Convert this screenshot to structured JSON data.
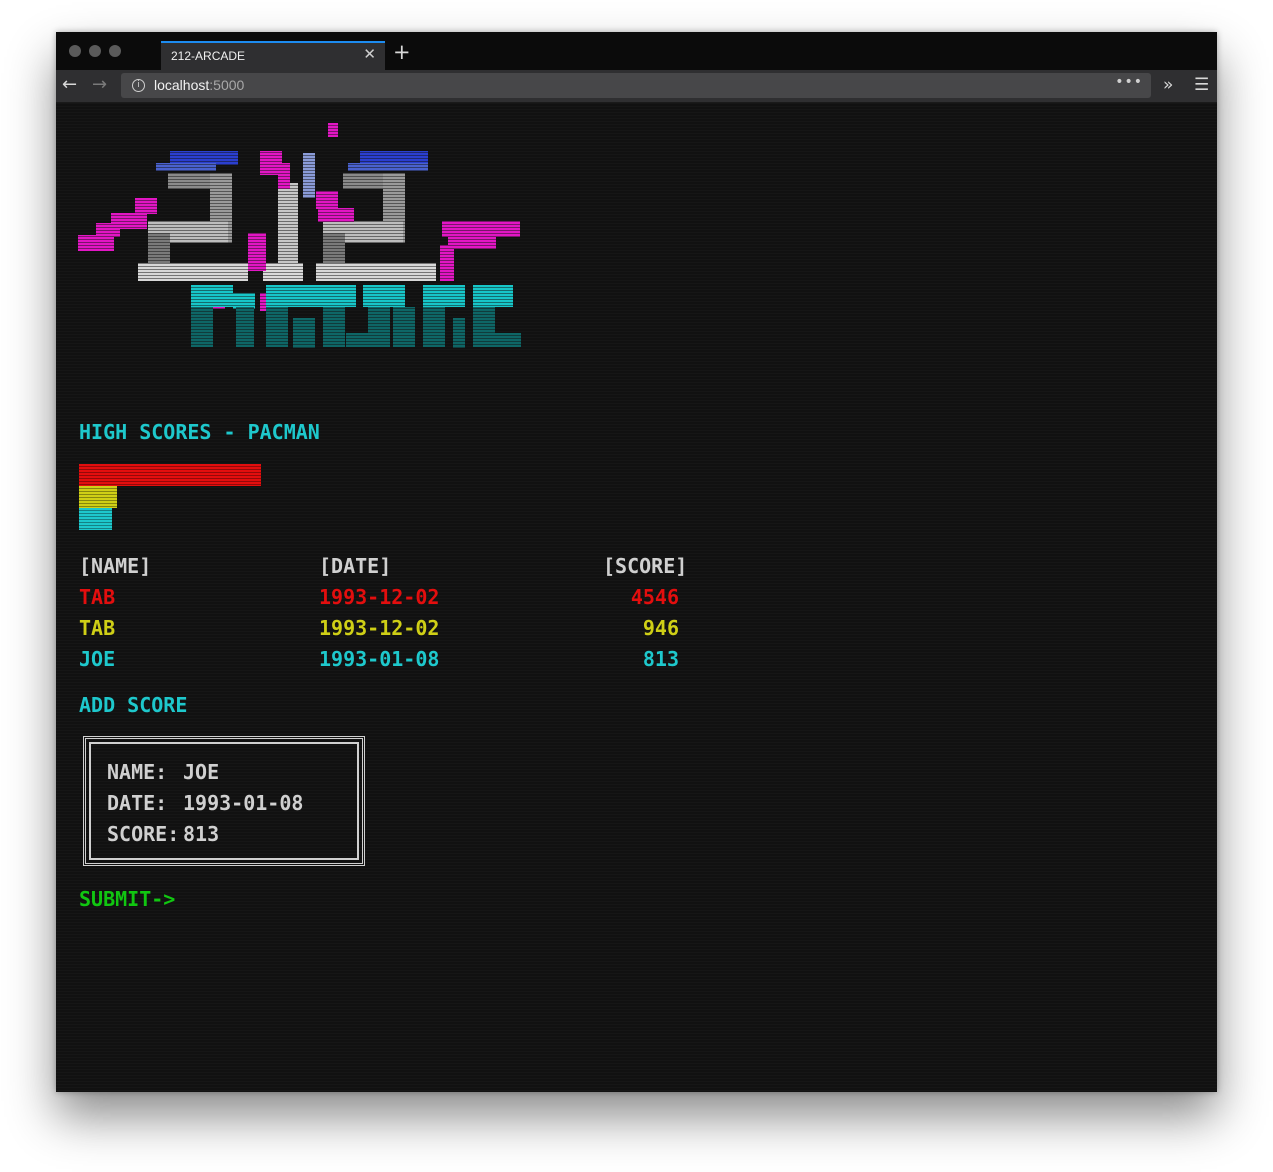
{
  "browser": {
    "tab_title": "212-ARCADE",
    "url_host": "localhost",
    "url_port": ":5000"
  },
  "page": {
    "heading": "HIGH SCORES - PACMAN",
    "columns": {
      "name": "[NAME]",
      "date": "[DATE]",
      "score": "[SCORE]"
    },
    "scores": [
      {
        "name": "TAB",
        "date": "1993-12-02",
        "score": "4546",
        "color": "#e30e0e"
      },
      {
        "name": "TAB",
        "date": "1993-12-02",
        "score": "946",
        "color": "#cfcf16"
      },
      {
        "name": "JOE",
        "date": "1993-01-08",
        "score": "813",
        "color": "#1ec8cc"
      }
    ],
    "score_bars": [
      4546,
      946,
      813
    ],
    "add_heading": "ADD SCORE",
    "form": {
      "name_label": "NAME:",
      "name_value": "JOE",
      "date_label": "DATE:",
      "date_value": "1993-01-08",
      "score_label": "SCORE:",
      "score_value": "813"
    },
    "submit_label": "SUBMIT->"
  },
  "colors": {
    "cyan": "#1ec8cc",
    "red": "#e30e0e",
    "yellow": "#cfcf16",
    "green": "#11c611",
    "header_gray": "#d0d0d0",
    "magenta": "#e216c4",
    "blue": "#2b3fd0"
  },
  "icons": [
    "back-arrow-icon",
    "forward-arrow-icon",
    "info-icon",
    "more-icon",
    "overflow-icon",
    "hamburger-menu-icon",
    "close-icon",
    "plus-icon"
  ]
}
